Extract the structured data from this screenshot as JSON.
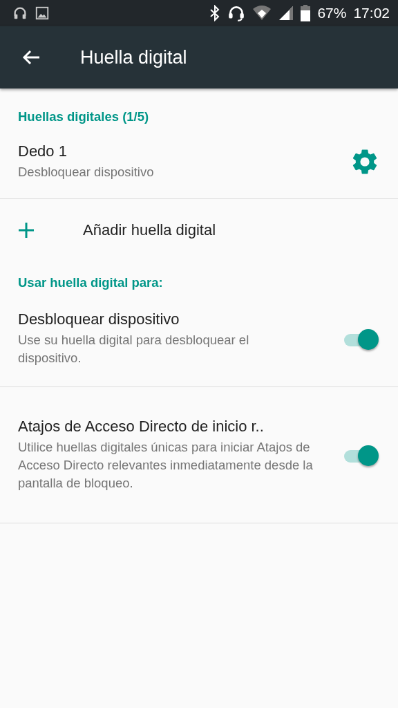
{
  "status_bar": {
    "battery": "67%",
    "time": "17:02"
  },
  "toolbar": {
    "title": "Huella digital"
  },
  "fingerprints": {
    "header": "Huellas digitales (1/5)",
    "items": [
      {
        "title": "Dedo 1",
        "subtitle": "Desbloquear dispositivo"
      }
    ],
    "add_label": "Añadir huella digital"
  },
  "usage": {
    "header": "Usar huella digital para:",
    "items": [
      {
        "title": "Desbloquear dispositivo",
        "summary": "Use su huella digital para desbloquear el dispositivo.",
        "on": true
      },
      {
        "title": "Atajos de Acceso Directo de inicio r..",
        "summary": "Utilice huellas digitales únicas para iniciar Atajos de Acceso Directo relevantes inmediatamente desde la pantalla de bloqueo.",
        "on": true
      }
    ]
  }
}
